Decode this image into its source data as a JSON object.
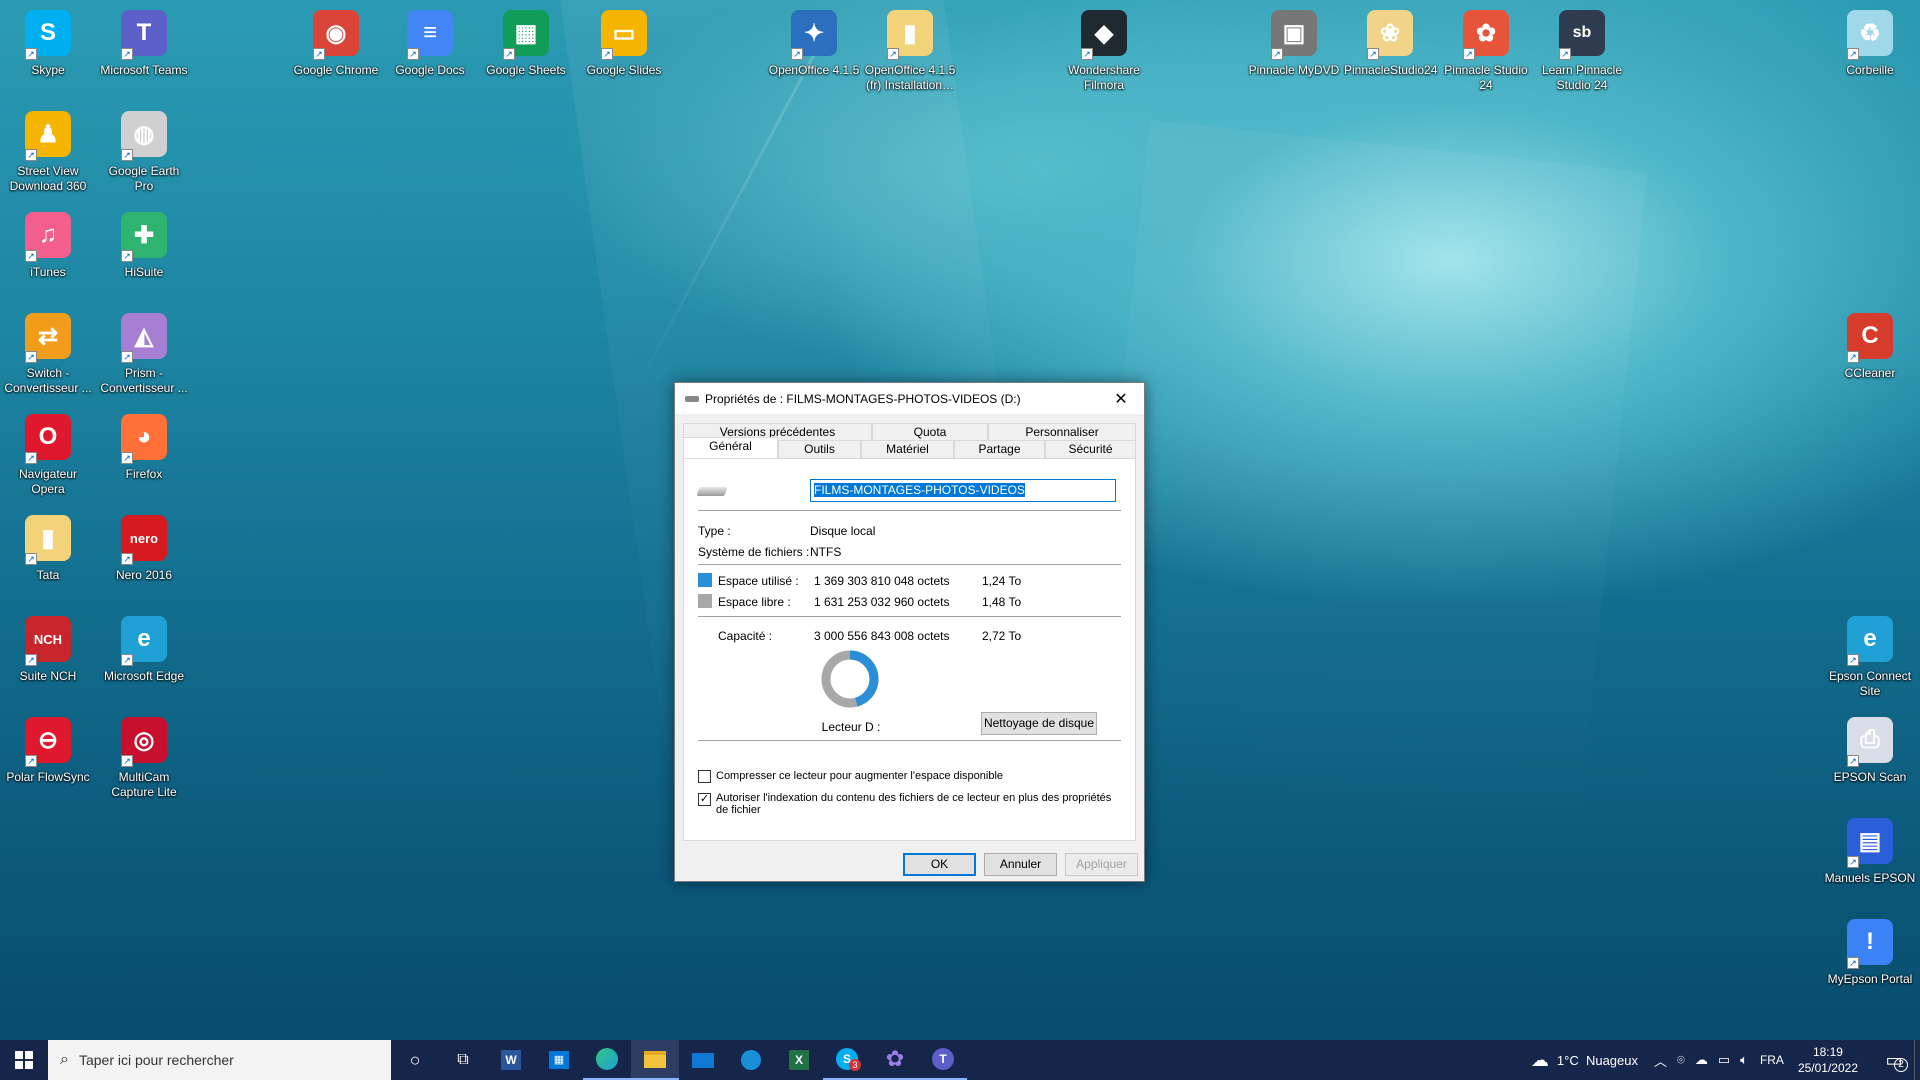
{
  "desktop": {
    "icons": [
      {
        "label": "Skype",
        "color": "#00aff0",
        "glyph": "S"
      },
      {
        "label": "Microsoft Teams",
        "color": "#5b5fc7",
        "glyph": "T"
      },
      {
        "label": "Google Chrome",
        "color": "#db4437",
        "glyph": "◉"
      },
      {
        "label": "Google Docs",
        "color": "#4285f4",
        "glyph": "≡"
      },
      {
        "label": "Google Sheets",
        "color": "#0f9d58",
        "glyph": "▦"
      },
      {
        "label": "Google Slides",
        "color": "#f4b400",
        "glyph": "▭"
      },
      {
        "label": "OpenOffice 4.1.5",
        "color": "#2c6fbf",
        "glyph": "✦"
      },
      {
        "label": "OpenOffice 4.1.5 (fr) Installation…",
        "color": "#f3d37a",
        "glyph": "▮"
      },
      {
        "label": "Wondershare Filmora",
        "color": "#1f2a30",
        "glyph": "◆"
      },
      {
        "label": "Pinnacle MyDVD",
        "color": "#777777",
        "glyph": "▣"
      },
      {
        "label": "PinnacleStudio24",
        "color": "#f2d38a",
        "glyph": "❀"
      },
      {
        "label": "Pinnacle Studio 24",
        "color": "#e8543a",
        "glyph": "✿"
      },
      {
        "label": "Learn Pinnacle Studio 24",
        "color": "#2f3c4f",
        "glyph": "sb"
      },
      {
        "label": "Corbeille",
        "color": "#9fd8e8",
        "glyph": "♻"
      },
      {
        "label": "Street View Download 360",
        "color": "#f4b400",
        "glyph": "♟"
      },
      {
        "label": "Google Earth Pro",
        "color": "#d0d0d0",
        "glyph": "◍"
      },
      {
        "label": "iTunes",
        "color": "#f25f8d",
        "glyph": "♫"
      },
      {
        "label": "HiSuite",
        "color": "#2fb46f",
        "glyph": "✚"
      },
      {
        "label": "Switch - Convertisseur ...",
        "color": "#f19c1b",
        "glyph": "⇄"
      },
      {
        "label": "Prism - Convertisseur ...",
        "color": "#a67fd3",
        "glyph": "◭"
      },
      {
        "label": "CCleaner",
        "color": "#d63b2b",
        "glyph": "C"
      },
      {
        "label": "Navigateur Opera",
        "color": "#e0182d",
        "glyph": "O"
      },
      {
        "label": "Firefox",
        "color": "#ff7139",
        "glyph": "◕"
      },
      {
        "label": "Tata",
        "color": "#f3d37a",
        "glyph": "▮"
      },
      {
        "label": "Nero 2016",
        "color": "#d71920",
        "glyph": "nero"
      },
      {
        "label": "Suite NCH",
        "color": "#c9252c",
        "glyph": "NCH"
      },
      {
        "label": "Microsoft Edge",
        "color": "#1fa1d6",
        "glyph": "e"
      },
      {
        "label": "Epson Connect Site",
        "color": "#1fa1d6",
        "glyph": "e"
      },
      {
        "label": "Polar FlowSync",
        "color": "#e0182d",
        "glyph": "⊖"
      },
      {
        "label": "MultiCam Capture Lite",
        "color": "#c8102e",
        "glyph": "◎"
      },
      {
        "label": "EPSON Scan",
        "color": "#d8dde8",
        "glyph": "⎙"
      },
      {
        "label": "Manuels EPSON",
        "color": "#2b5fd9",
        "glyph": "▤"
      },
      {
        "label": "MyEpson Portal",
        "color": "#3b82f6",
        "glyph": "!"
      }
    ]
  },
  "dialog": {
    "title": "Propriétés de : FILMS-MONTAGES-PHOTOS-VIDEOS (D:)",
    "tabs_row1": [
      "Versions précédentes",
      "Quota",
      "Personnaliser"
    ],
    "tabs_row2": [
      "Général",
      "Outils",
      "Matériel",
      "Partage",
      "Sécurité"
    ],
    "active_tab": "Général",
    "drive_name": "FILMS-MONTAGES-PHOTOS-VIDEOS",
    "type_label": "Type :",
    "type_value": "Disque local",
    "fs_label": "Système de fichiers :",
    "fs_value": "NTFS",
    "used_label": "Espace utilisé :",
    "used_bytes": "1 369 303 810 048 octets",
    "used_human": "1,24 To",
    "free_label": "Espace libre :",
    "free_bytes": "1 631 253 032 960 octets",
    "free_human": "1,48 To",
    "capacity_label": "Capacité :",
    "capacity_bytes": "3 000 556 843 008 octets",
    "capacity_human": "2,72 To",
    "used_fraction": 0.456,
    "used_color": "#2a8fd6",
    "free_color": "#a8a8a8",
    "drive_label": "Lecteur D :",
    "cleanup_button": "Nettoyage de disque",
    "compress_label": "Compresser ce lecteur pour augmenter l'espace disponible",
    "compress_checked": false,
    "index_label": "Autoriser l'indexation du contenu des fichiers de ce lecteur en plus des propriétés de fichier",
    "index_checked": true,
    "ok": "OK",
    "cancel": "Annuler",
    "apply": "Appliquer"
  },
  "taskbar": {
    "search_placeholder": "Taper ici pour rechercher",
    "weather": "1°C  Nuageux",
    "language": "FRA",
    "time": "18:19",
    "date": "25/01/2022",
    "notifications": "2",
    "skype_badge": "3"
  }
}
